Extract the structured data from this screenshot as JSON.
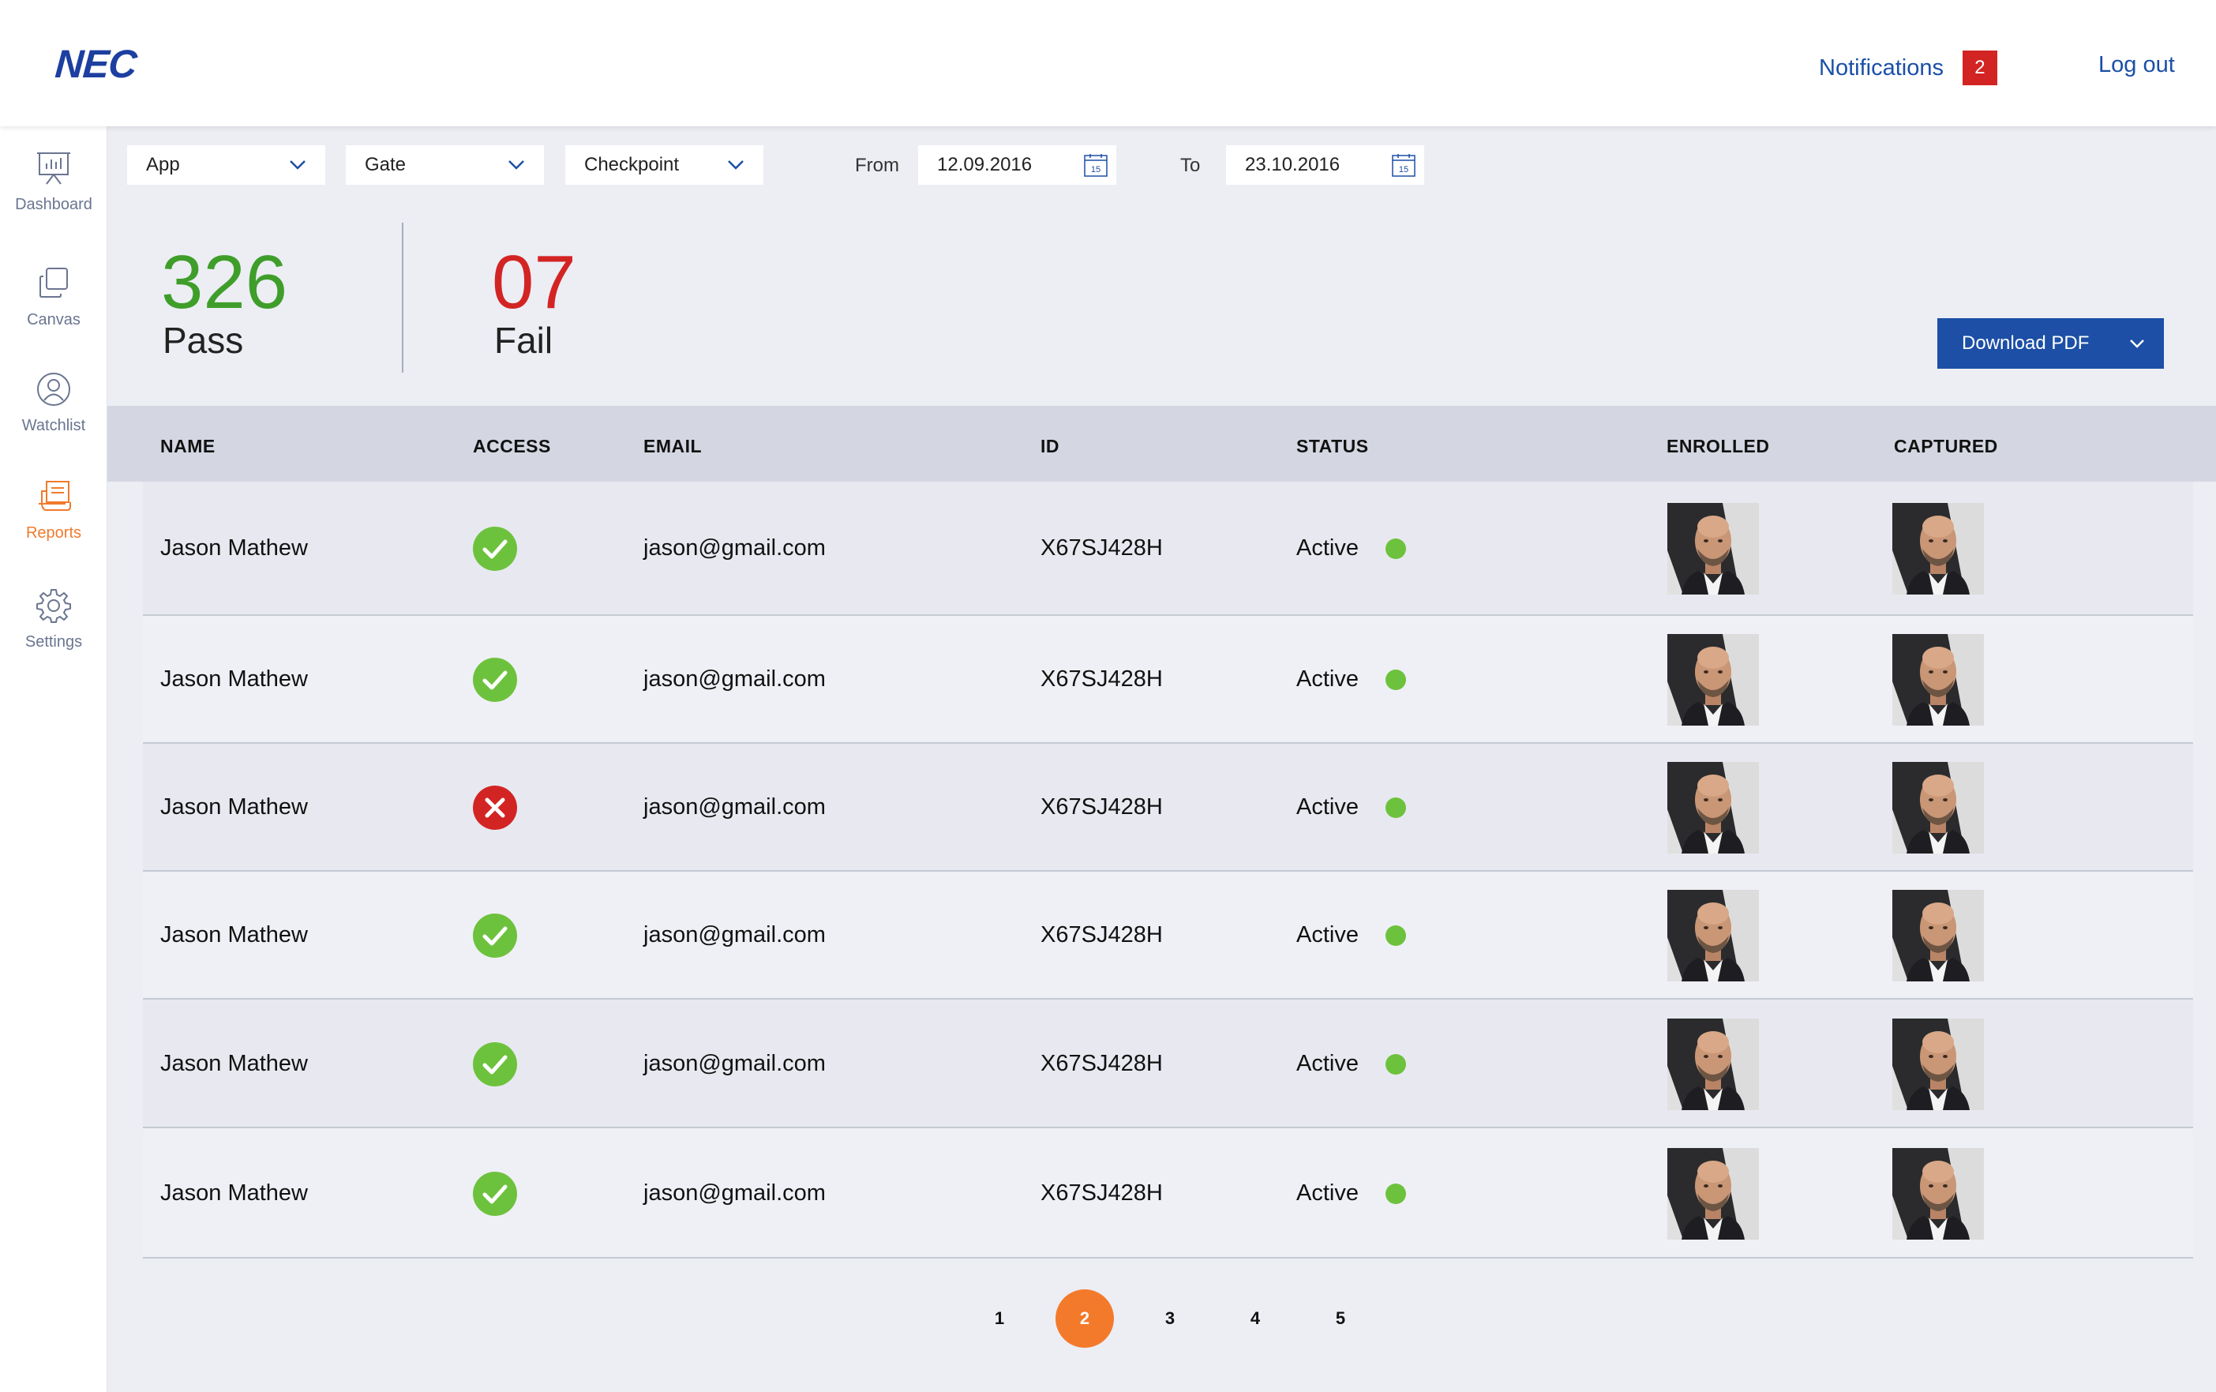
{
  "header": {
    "logo": "NEC",
    "notifications_label": "Notifications",
    "notifications_count": "2",
    "logout_label": "Log out"
  },
  "sidebar": {
    "items": [
      {
        "label": "Dashboard",
        "icon": "presentation-chart-icon",
        "active": false
      },
      {
        "label": "Canvas",
        "icon": "stacked-squares-icon",
        "active": false
      },
      {
        "label": "Watchlist",
        "icon": "user-circle-icon",
        "active": false
      },
      {
        "label": "Reports",
        "icon": "reports-icon",
        "active": true
      },
      {
        "label": "Settings",
        "icon": "gear-icon",
        "active": false
      }
    ]
  },
  "filters": {
    "app": "App",
    "gate": "Gate",
    "checkpoint": "Checkpoint",
    "from_label": "From",
    "from_value": "12.09.2016",
    "to_label": "To",
    "to_value": "23.10.2016",
    "calendar_day": "15"
  },
  "stats": {
    "pass_value": "326",
    "pass_label": "Pass",
    "fail_value": "07",
    "fail_label": "Fail"
  },
  "download_label": "Download PDF",
  "table": {
    "columns": [
      "NAME",
      "ACCESS",
      "EMAIL",
      "ID",
      "STATUS",
      "ENROLLED",
      "CAPTURED"
    ],
    "rows": [
      {
        "name": "Jason Mathew",
        "access": "granted",
        "email": "jason@gmail.com",
        "id": "X67SJ428H",
        "status": "Active"
      },
      {
        "name": "Jason Mathew",
        "access": "granted",
        "email": "jason@gmail.com",
        "id": "X67SJ428H",
        "status": "Active"
      },
      {
        "name": "Jason Mathew",
        "access": "denied",
        "email": "jason@gmail.com",
        "id": "X67SJ428H",
        "status": "Active"
      },
      {
        "name": "Jason Mathew",
        "access": "granted",
        "email": "jason@gmail.com",
        "id": "X67SJ428H",
        "status": "Active"
      },
      {
        "name": "Jason Mathew",
        "access": "granted",
        "email": "jason@gmail.com",
        "id": "X67SJ428H",
        "status": "Active"
      },
      {
        "name": "Jason Mathew",
        "access": "granted",
        "email": "jason@gmail.com",
        "id": "X67SJ428H",
        "status": "Active"
      }
    ]
  },
  "pagination": {
    "pages": [
      "1",
      "2",
      "3",
      "4",
      "5"
    ],
    "current": "2"
  },
  "colors": {
    "brand_blue": "#1c4fa5",
    "pass_green": "#3f9e2a",
    "fail_red": "#d32424",
    "active_orange": "#f47a2b",
    "status_green": "#6dc23d"
  }
}
